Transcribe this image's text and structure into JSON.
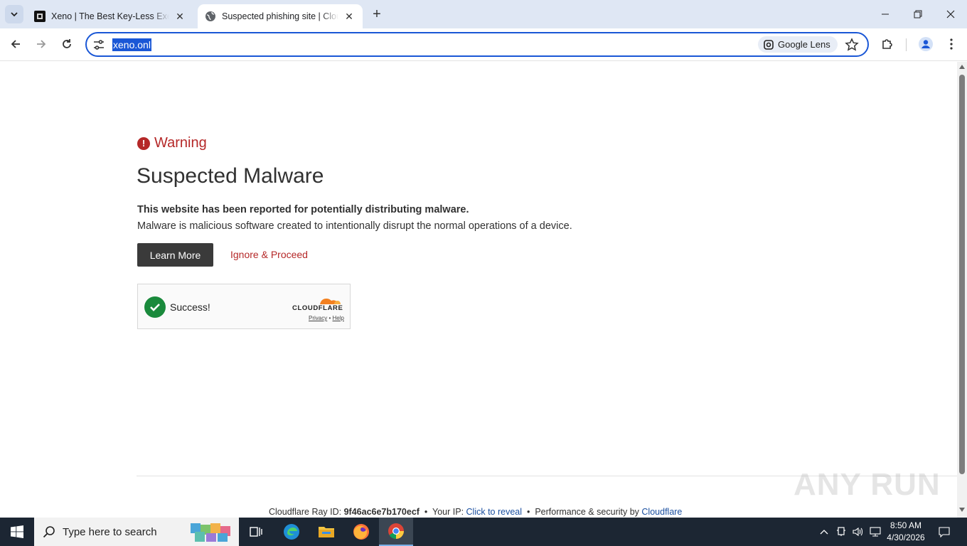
{
  "browser": {
    "tabs": [
      {
        "title": "Xeno | The Best Key-Less Executor",
        "active": false
      },
      {
        "title": "Suspected phishing site | Cloudflare",
        "active": true
      }
    ],
    "address_bar": {
      "url": "xeno.onl"
    },
    "lens_label": "Google Lens"
  },
  "page": {
    "warning_label": "Warning",
    "heading": "Suspected Malware",
    "bold_text": "This website has been reported for potentially distributing malware.",
    "description": "Malware is malicious software created to intentionally disrupt the normal operations of a device.",
    "learn_more": "Learn More",
    "ignore_proceed": "Ignore & Proceed",
    "turnstile": {
      "status": "Success!",
      "brand": "CLOUDFLARE",
      "privacy": "Privacy",
      "separator": "•",
      "help": "Help"
    },
    "footer": {
      "ray_label": "Cloudflare Ray ID:",
      "ray_id": "9f46ac6e7b170ecf",
      "bullet": "•",
      "ip_label": "Your IP:",
      "ip_link": "Click to reveal",
      "perf_label": "Performance & security by",
      "cf_link": "Cloudflare"
    },
    "watermark": "ANY RUN"
  },
  "taskbar": {
    "search_placeholder": "Type here to search",
    "time": "8:50 AM",
    "date": "4/30/2026"
  },
  "colors": {
    "accent_blue": "#1a57d6",
    "warning_red": "#b52828",
    "success_green": "#1a8a3c",
    "cloudflare_orange": "#f38020"
  }
}
